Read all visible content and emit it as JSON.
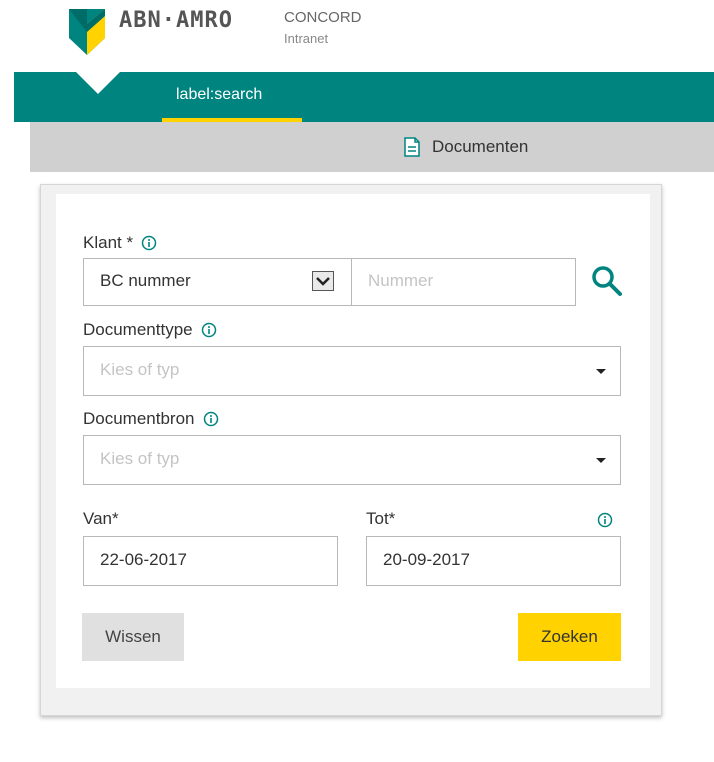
{
  "header": {
    "brand": "ABN·AMRO",
    "app_name": "CONCORD",
    "app_sub": "Intranet"
  },
  "nav": {
    "tab_label": "label:search"
  },
  "subnav": {
    "documents_label": "Documenten"
  },
  "form": {
    "klant": {
      "label": "Klant *",
      "type_value": "BC nummer",
      "number_placeholder": "Nummer"
    },
    "documenttype": {
      "label": "Documenttype",
      "placeholder": "Kies of typ"
    },
    "documentbron": {
      "label": "Documentbron",
      "placeholder": "Kies of typ"
    },
    "van": {
      "label": "Van*",
      "value": "22-06-2017"
    },
    "tot": {
      "label": "Tot*",
      "value": "20-09-2017"
    },
    "clear_button": "Wissen",
    "search_button": "Zoeken"
  },
  "colors": {
    "teal": "#00847f",
    "yellow": "#ffd200",
    "subbar": "#d0d0d0"
  },
  "icons": {
    "logo": "abn-amro-shield-icon",
    "document": "document-icon",
    "info": "info-icon",
    "search": "search-icon",
    "dropdown": "chevron-down-icon"
  }
}
